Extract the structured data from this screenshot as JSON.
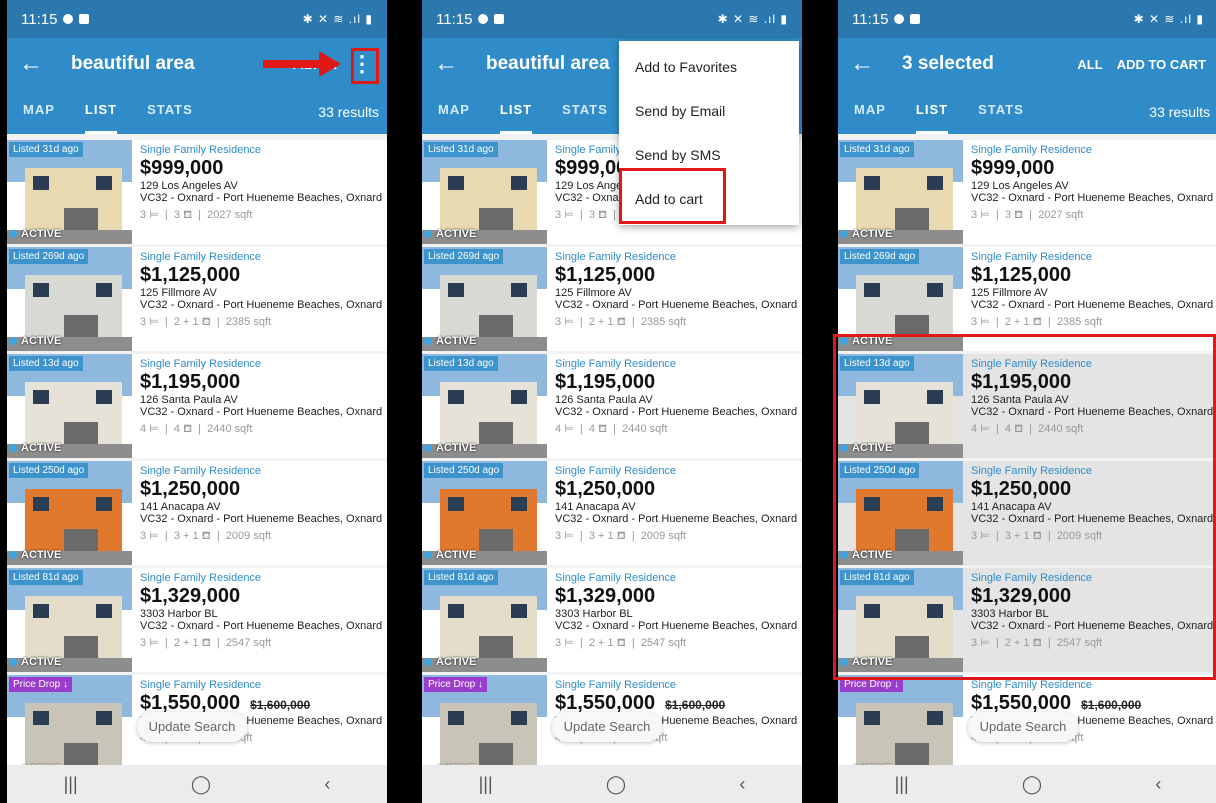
{
  "status": {
    "time": "11:15",
    "icons": "✱ ✕ ≋ .ıl ▮"
  },
  "panels": [
    {
      "title": "beautiful area",
      "actions": [
        "FILTER"
      ],
      "menu": false
    },
    {
      "title": "beautiful area",
      "actions": [],
      "menu": true
    },
    {
      "title": "3 selected",
      "actions": [
        "ALL",
        "ADD TO CART"
      ],
      "menu": false
    }
  ],
  "tabs": [
    "MAP",
    "LIST",
    "STATS"
  ],
  "results": "33 results",
  "menu_items": [
    "Add to Favorites",
    "Send by Email",
    "Send by SMS",
    "Add to cart"
  ],
  "update_search": "Update Search",
  "listings": [
    {
      "listed": "Listed 31d ago",
      "type": "Single Family Residence",
      "price": "$999,000",
      "address": "129 Los Angeles AV",
      "area": "VC32 - Oxnard - Port Hueneme Beaches, Oxnard",
      "beds": "3",
      "baths": "3",
      "sqft": "2027 sqft",
      "status": "ACTIVE",
      "house_color": "#e8d9b0"
    },
    {
      "listed": "Listed 269d ago",
      "type": "Single Family Residence",
      "price": "$1,125,000",
      "address": "125 Fillmore AV",
      "area": "VC32 - Oxnard - Port Hueneme Beaches, Oxnard",
      "beds": "3",
      "baths": "2 + 1",
      "sqft": "2385 sqft",
      "status": "ACTIVE",
      "house_color": "#d9d9d4"
    },
    {
      "listed": "Listed 13d ago",
      "type": "Single Family Residence",
      "price": "$1,195,000",
      "address": "126 Santa Paula AV",
      "area": "VC32 - Oxnard - Port Hueneme Beaches, Oxnard",
      "beds": "4",
      "baths": "4",
      "sqft": "2440 sqft",
      "status": "ACTIVE",
      "house_color": "#e6e2d8"
    },
    {
      "listed": "Listed 250d ago",
      "type": "Single Family Residence",
      "price": "$1,250,000",
      "address": "141 Anacapa AV",
      "area": "VC32 - Oxnard - Port Hueneme Beaches, Oxnard",
      "beds": "3",
      "baths": "3 + 1",
      "sqft": "2009 sqft",
      "status": "ACTIVE",
      "house_color": "#e0782e"
    },
    {
      "listed": "Listed 81d ago",
      "type": "Single Family Residence",
      "price": "$1,329,000",
      "address": "3303 Harbor BL",
      "area": "VC32 - Oxnard - Port Hueneme Beaches, Oxnard",
      "beds": "3",
      "baths": "2 + 1",
      "sqft": "2547 sqft",
      "status": "ACTIVE",
      "house_color": "#e2dcc8"
    },
    {
      "listed": "Price Drop ↓",
      "type": "Single Family Residence",
      "price": "$1,550,000",
      "old_price": "$1,600,000",
      "address": "",
      "area": "VC32 - Oxnard - Port Hueneme Beaches, Oxnard",
      "beds": "4",
      "baths": "2",
      "sqft": "3226 sqft",
      "status": "ACTIVE",
      "house_color": "#c9c4b8",
      "price_drop": true
    }
  ],
  "selected_rows": [
    2,
    3,
    4
  ],
  "nav": [
    "|||",
    "◯",
    "‹"
  ],
  "colors": {
    "primary": "#2f8cc8",
    "status": "#2a78ad",
    "highlight": "#e01818",
    "price_drop": "#9b3dcc"
  }
}
